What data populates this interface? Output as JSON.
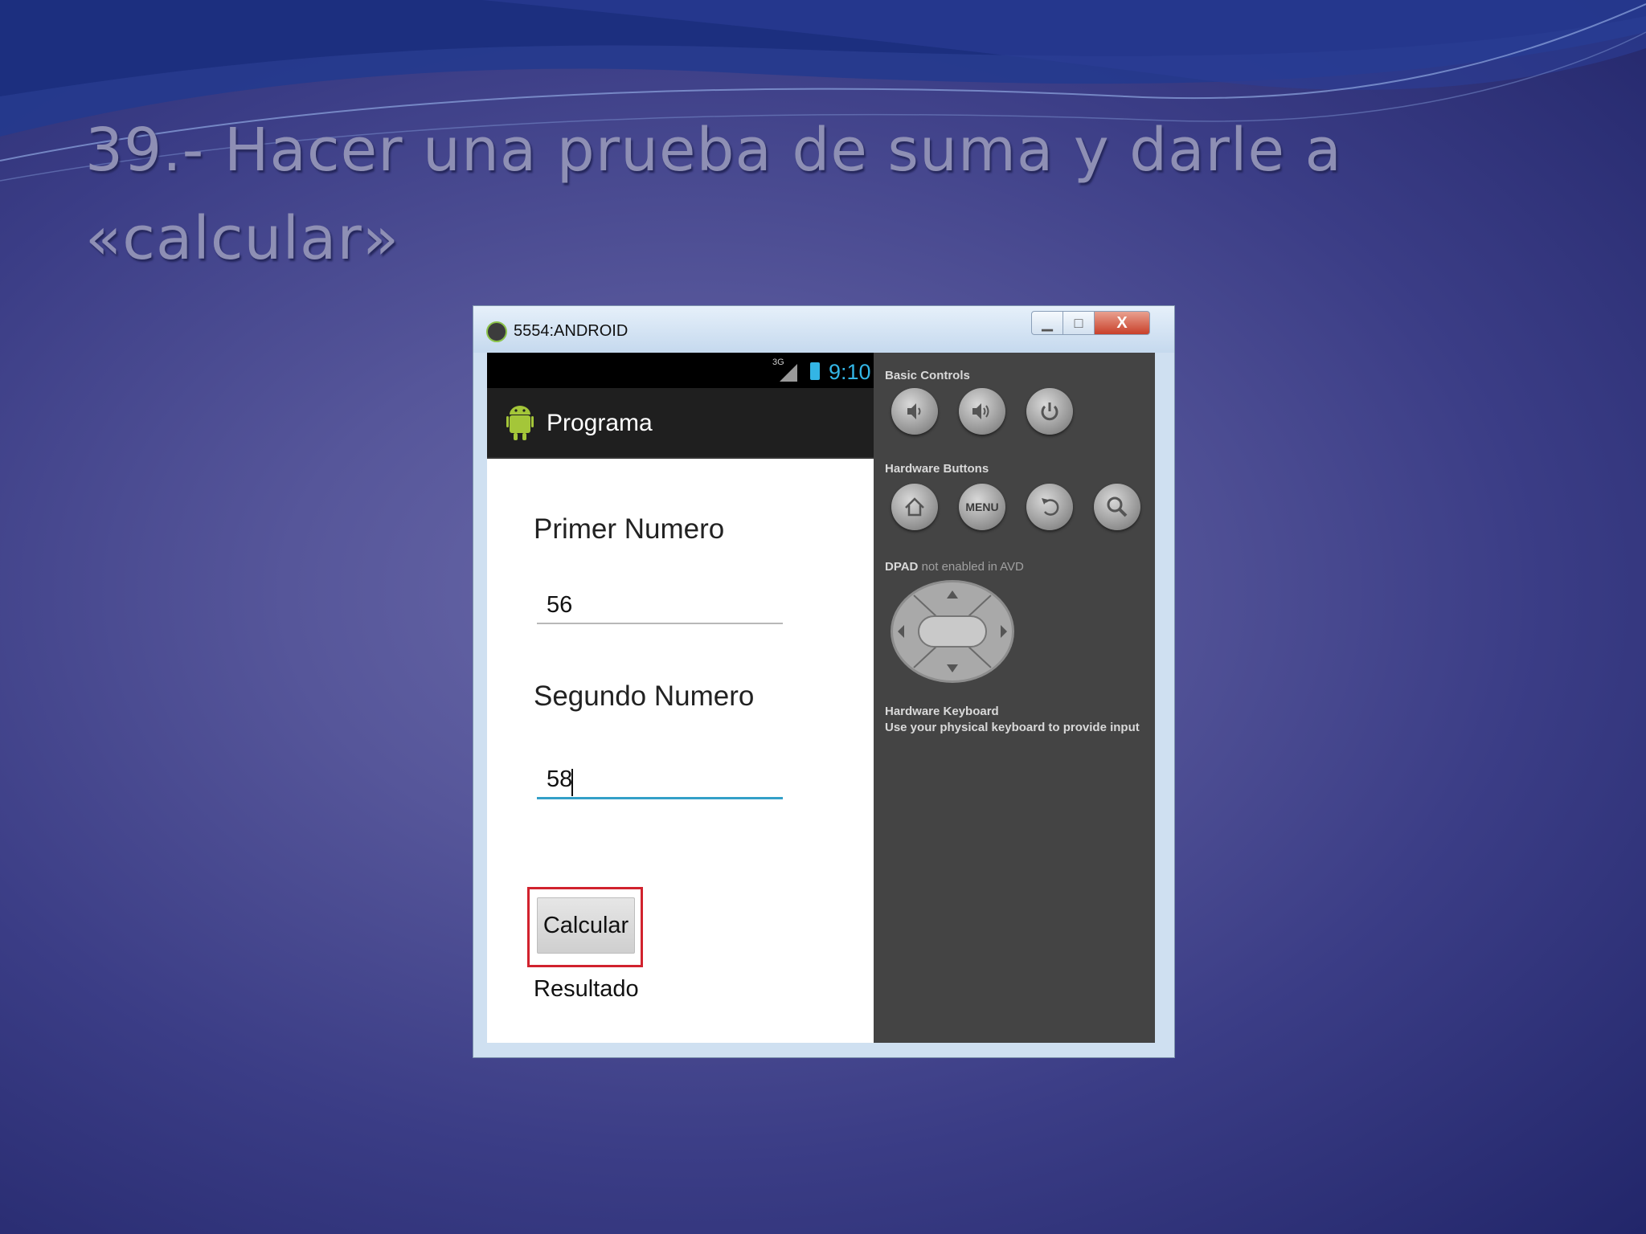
{
  "slide": {
    "title_line1": "39.- Hacer una prueba de suma y darle a",
    "title_line2": "«calcular»"
  },
  "window": {
    "title": "5554:ANDROID",
    "minimize_icon": "minimize-icon",
    "maximize_icon": "maximize-icon",
    "close_label": "X"
  },
  "phone": {
    "status": {
      "network": "3G",
      "time": "9:10"
    },
    "app_title": "Programa",
    "first_label": "Primer Numero",
    "first_value": "56",
    "second_label": "Segundo Numero",
    "second_value": "58",
    "button_label": "Calcular",
    "result_label": "Resultado"
  },
  "controls": {
    "basic_title": "Basic Controls",
    "hardware_title": "Hardware Buttons",
    "menu_label": "MENU",
    "dpad_title": "DPAD",
    "dpad_note": "not enabled in AVD",
    "keyboard_title": "Hardware Keyboard",
    "keyboard_note": "Use your physical keyboard to provide input"
  },
  "colors": {
    "highlight": "#d1222e",
    "accent": "#33b5e5"
  }
}
